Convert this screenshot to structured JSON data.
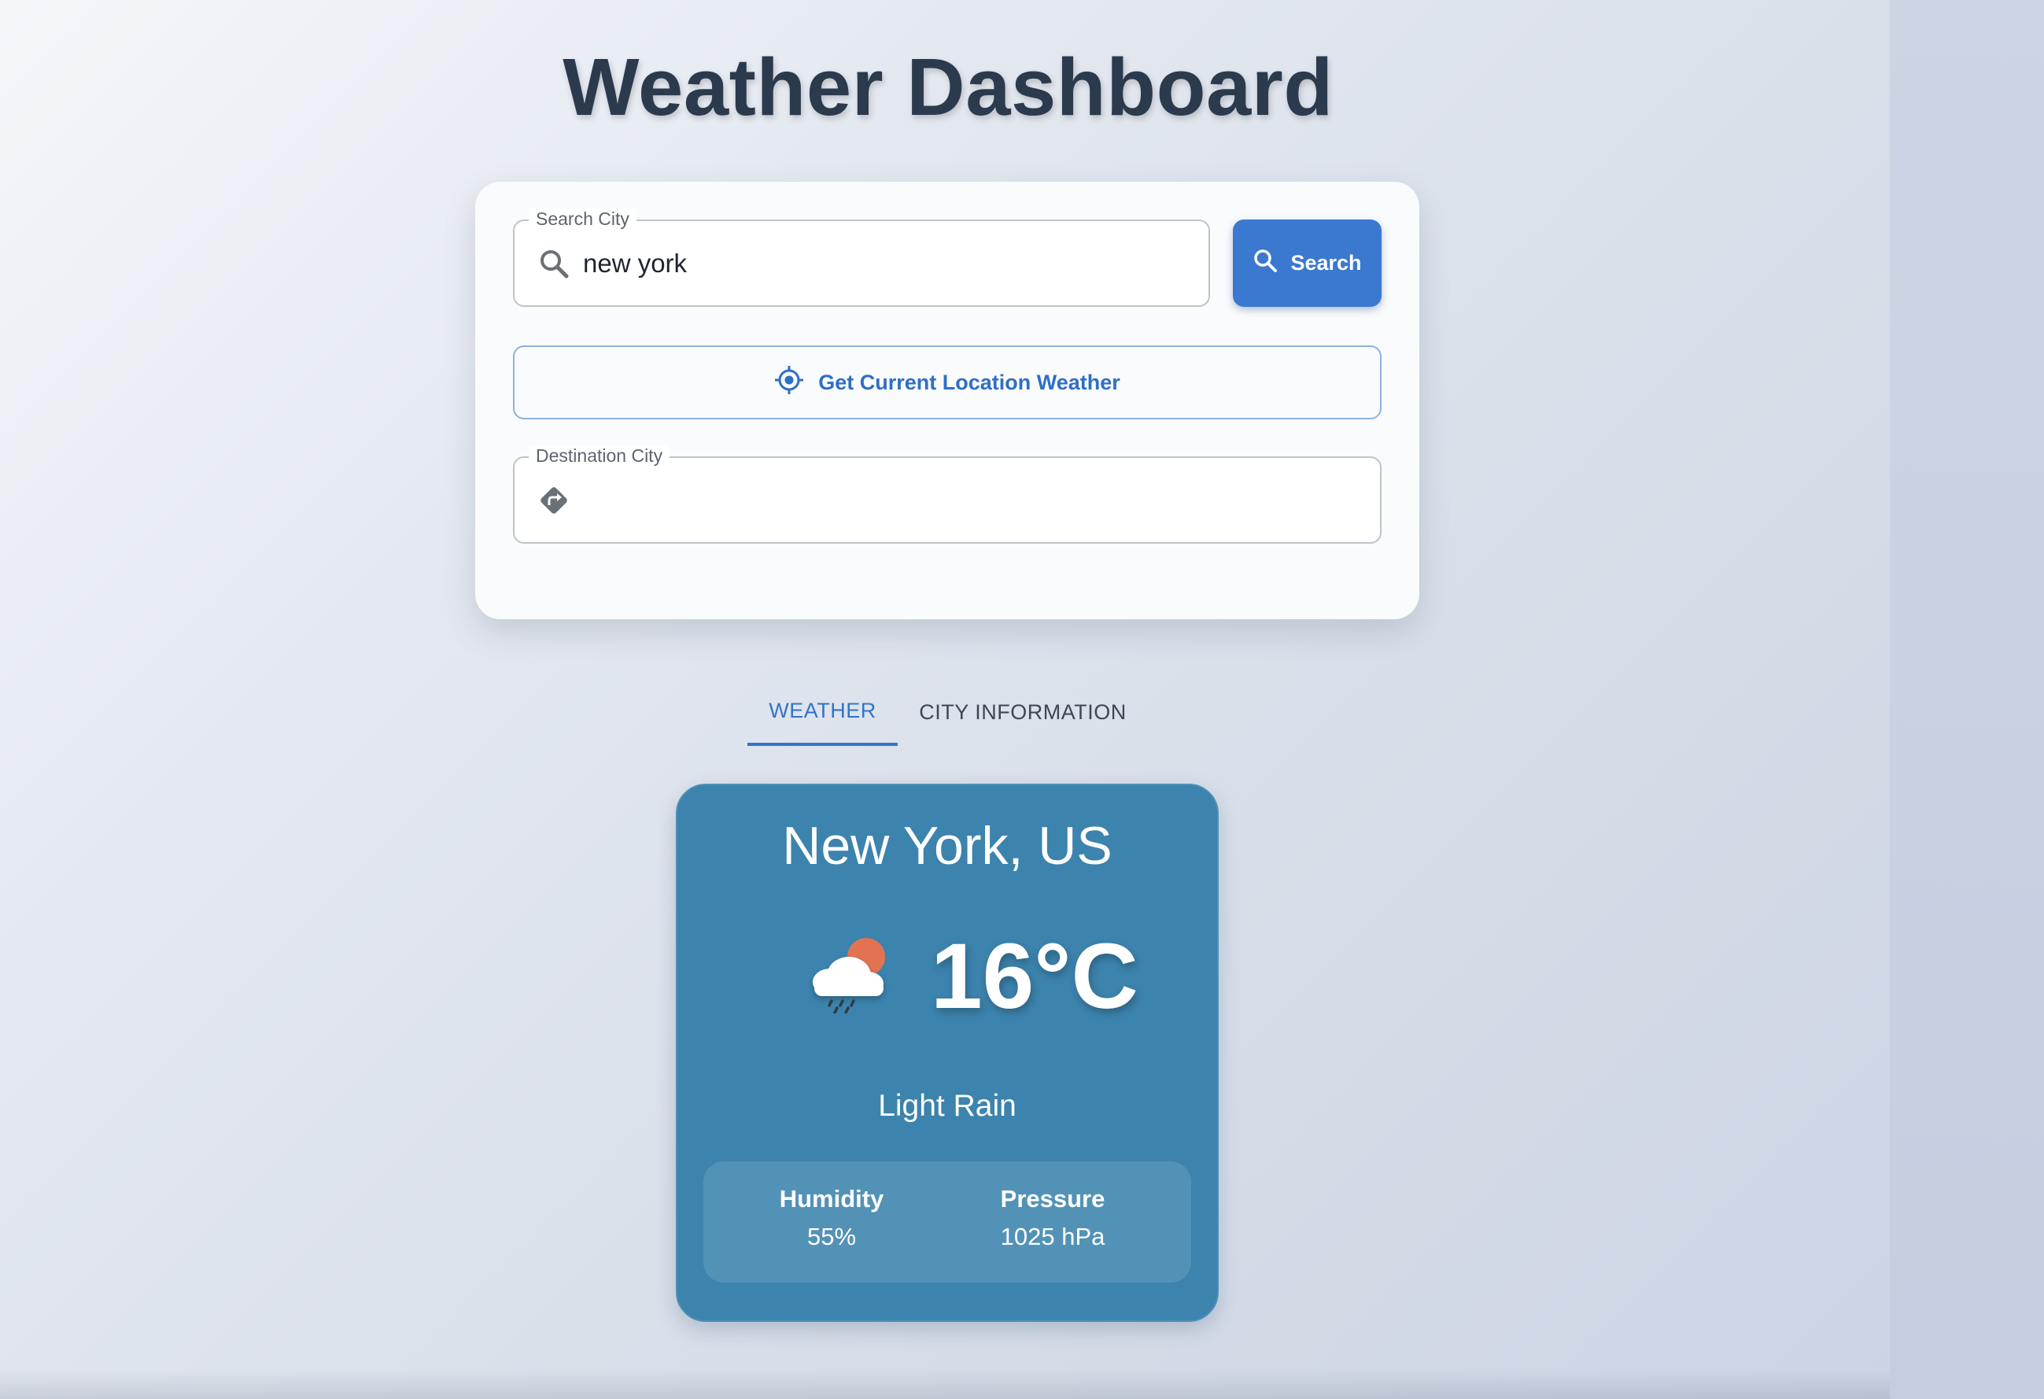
{
  "header": {
    "title": "Weather Dashboard"
  },
  "search": {
    "city_label": "Search City",
    "city_value": "new york",
    "search_button": "Search",
    "location_button": "Get Current Location Weather",
    "destination_label": "Destination City",
    "destination_value": ""
  },
  "tabs": [
    {
      "label": "WEATHER",
      "active": true
    },
    {
      "label": "CITY INFORMATION",
      "active": false
    }
  ],
  "weather": {
    "city": "New York, US",
    "temperature": "16°C",
    "condition": "Light Rain",
    "icon": "light-rain-icon",
    "stats": [
      {
        "label": "Humidity",
        "value": "55%"
      },
      {
        "label": "Pressure",
        "value": "1025 hPa"
      }
    ]
  },
  "colors": {
    "primary": "#3b78d0",
    "card": "#3c83ad",
    "title": "#2c3a4e"
  }
}
